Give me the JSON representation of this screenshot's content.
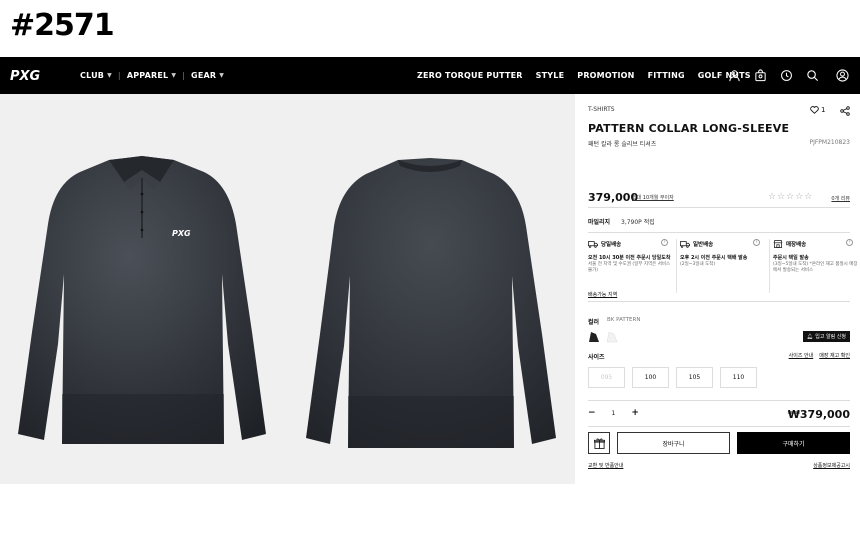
{
  "tag": "#2571",
  "nav": {
    "logo": "PXG",
    "left_menu": [
      {
        "label": "CLUB"
      },
      {
        "label": "APPAREL"
      },
      {
        "label": "GEAR"
      }
    ],
    "right_menu": [
      "ZERO TORQUE PUTTER",
      "STYLE",
      "PROMOTION",
      "FITTING",
      "GOLF NUTS"
    ],
    "icons": [
      "user-icon",
      "bag-icon",
      "history-icon",
      "search-icon"
    ],
    "account_icon": "account-circle-icon"
  },
  "gallery": {
    "front_logo": "PXG"
  },
  "product": {
    "category": "T-SHIRTS",
    "like_count": "1",
    "title": "PATTERN COLLAR LONG-SLEEVE",
    "subtitle": "패턴 칼라 롱 슬리브 티셔츠",
    "code": "PJFPM210823",
    "price": "379,000",
    "installment": "최대 10개월 무이자",
    "stars": "☆☆☆☆☆",
    "review_link": "0개 리뷰",
    "mileage_label": "마일리지",
    "mileage_value": "3,790P 적립"
  },
  "delivery": {
    "options": [
      {
        "head": "당일배송",
        "title": "오전 10시 30분 이전 주문시 당일도착",
        "note": "서울 전 지역 및 수도권 (일부 지역은 서비스 불가)"
      },
      {
        "head": "일반배송",
        "title": "오후 2시 이전 주문시 택배 발송",
        "note": "(2일~3일내 도착)"
      },
      {
        "head": "매장배송",
        "title": "주문시 택일 발송",
        "note": "(3일~5일내 도착) *온라인 재고 품절시 매장에서 발송되는 서비스"
      }
    ],
    "link": "배송가능 지역"
  },
  "options": {
    "color_label": "컬러",
    "color_value": "BK PATTERN",
    "restock_label": "입고 알림 신청",
    "size_label": "사이즈",
    "size_links": [
      "사이즈 안내",
      "매장 재고 확인"
    ],
    "sizes": [
      {
        "label": "095",
        "soldout": true
      },
      {
        "label": "100",
        "soldout": false
      },
      {
        "label": "105",
        "soldout": false
      },
      {
        "label": "110",
        "soldout": false
      }
    ]
  },
  "order": {
    "minus": "−",
    "quantity": "1",
    "plus": "+",
    "total": "₩379,000",
    "cart_label": "장바구니",
    "buy_label": "구매하기",
    "footer_left": "교환 및 반품안내",
    "footer_right": "상품정보제공고시"
  },
  "colors": {
    "nav_bg": "#000000",
    "gallery_bg": "#f0f0f0",
    "shirt": "#2b2f35",
    "accent": "#000000"
  }
}
